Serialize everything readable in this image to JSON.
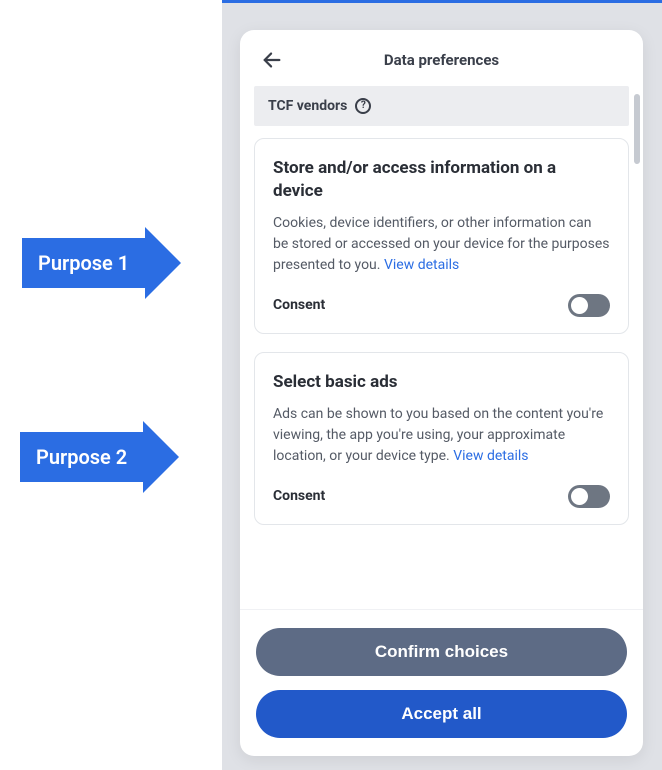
{
  "annotations": {
    "purpose1": "Purpose 1",
    "purpose2": "Purpose 2"
  },
  "modal": {
    "title": "Data preferences",
    "section": {
      "title": "TCF vendors",
      "help_icon": "?"
    },
    "cards": [
      {
        "title": "Store and/or access information on a device",
        "desc": "Cookies, device identifiers, or other information can be stored or accessed on your device for the purposes presented to you. ",
        "view_details": "View details",
        "consent_label": "Consent"
      },
      {
        "title": "Select basic ads",
        "desc": "Ads can be shown to you based on the content you're viewing, the app you're using, your approximate location, or your device type. ",
        "view_details": "View details",
        "consent_label": "Consent"
      }
    ],
    "footer": {
      "confirm": "Confirm choices",
      "accept": "Accept all"
    }
  }
}
